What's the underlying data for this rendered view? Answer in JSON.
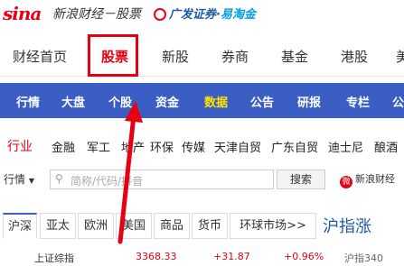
{
  "header": {
    "sina_logo": "sina",
    "subtitle": "新浪财经－股票",
    "partner_a": "广发证券",
    "partner_dot": "·",
    "partner_b": "易淘金"
  },
  "nav_main": [
    "财经首页",
    "股票",
    "新股",
    "券商",
    "基金",
    "港股",
    "美"
  ],
  "nav_sub": [
    "行情",
    "大盘",
    "个股",
    "资金",
    "数据",
    "公告",
    "研报",
    "专栏",
    "公"
  ],
  "industry": {
    "label": "行业",
    "items": [
      "金融",
      "军工",
      "地产",
      "环保",
      "传媒",
      "天津自贸",
      "广东自贸",
      "迪士尼",
      "酿酒"
    ]
  },
  "search": {
    "select_label": "行情",
    "placeholder": "简称/代码/拼音",
    "button": "搜索",
    "weibo": "新浪财经"
  },
  "market_tabs": [
    "沪深",
    "亚太",
    "欧洲",
    "美国",
    "商品",
    "货币",
    "环球市场>>"
  ],
  "big_title": "沪指涨",
  "index_row": {
    "name": "上证综指",
    "value": "3368.33",
    "change": "+31.87",
    "percent": "+0.96%",
    "extra": "沪指340"
  },
  "colors": {
    "accent_red": "#e60012",
    "nav_blue": "#3a5ec4",
    "highlight_yellow": "#ffe400"
  }
}
